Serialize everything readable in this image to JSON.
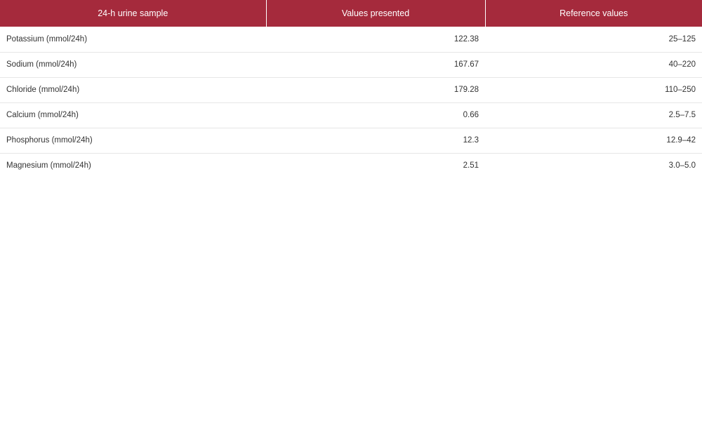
{
  "table": {
    "headers": [
      "24-h urine sample",
      "Values presented",
      "Reference values"
    ],
    "rows": [
      {
        "name": "Potassium (mmol/24h)",
        "value": "122.38",
        "reference": "25–125"
      },
      {
        "name": "Sodium (mmol/24h)",
        "value": "167.67",
        "reference": "40–220"
      },
      {
        "name": "Chloride (mmol/24h)",
        "value": "179.28",
        "reference": "110–250"
      },
      {
        "name": "Calcium (mmol/24h)",
        "value": "0.66",
        "reference": "2.5–7.5"
      },
      {
        "name": "Phosphorus (mmol/24h)",
        "value": "12.3",
        "reference": "12.9–42"
      },
      {
        "name": "Magnesium (mmol/24h)",
        "value": "2.51",
        "reference": "3.0–5.0"
      }
    ]
  },
  "colors": {
    "header_background": "#a52a3c",
    "header_text": "#ffffff",
    "row_divider": "#e6e6e6"
  }
}
